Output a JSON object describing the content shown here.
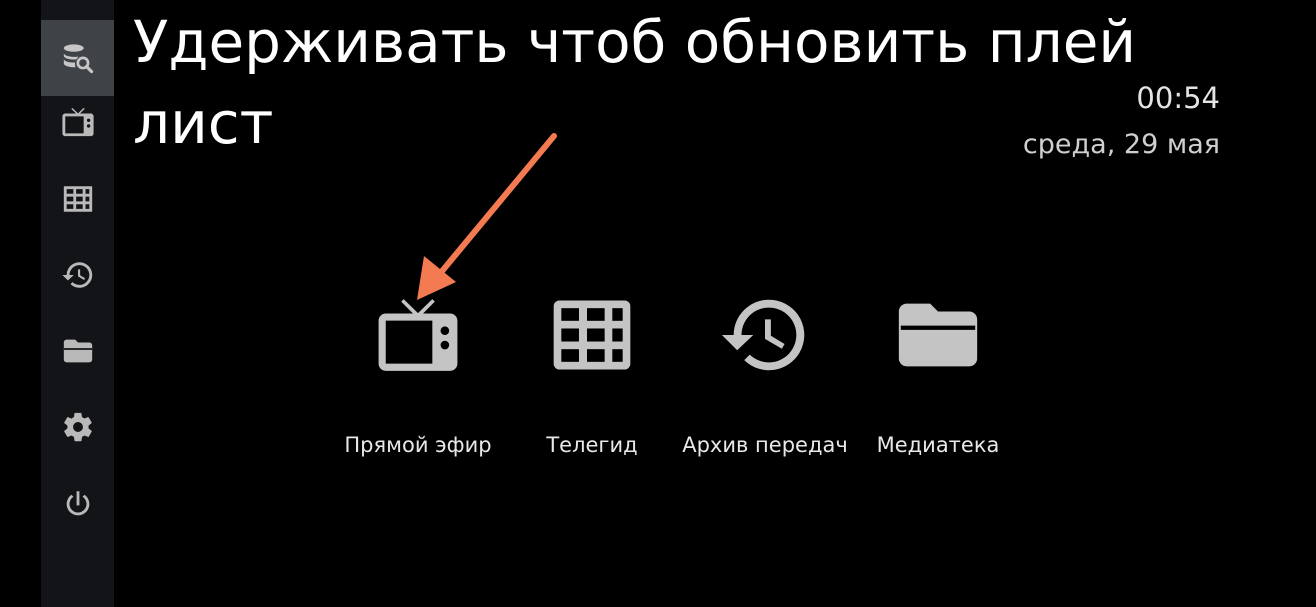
{
  "header": {
    "hint": "Удерживать чтоб обновить плей лист",
    "time": "00:54",
    "date": "среда, 29 мая"
  },
  "sidebar": {
    "items": [
      {
        "icon": "database-search-icon",
        "active": true
      },
      {
        "icon": "tv-icon",
        "active": false
      },
      {
        "icon": "grid-icon",
        "active": false
      },
      {
        "icon": "history-icon",
        "active": false
      },
      {
        "icon": "folder-icon",
        "active": false
      },
      {
        "icon": "gear-icon",
        "active": false
      },
      {
        "icon": "power-icon",
        "active": false
      }
    ]
  },
  "menu": {
    "items": [
      {
        "label": "Прямой эфир",
        "icon": "tv-icon"
      },
      {
        "label": "Телегид",
        "icon": "grid-icon"
      },
      {
        "label": "Архив передач",
        "icon": "history-icon"
      },
      {
        "label": "Медиатека",
        "icon": "folder-icon"
      }
    ]
  },
  "colors": {
    "background": "#000000",
    "sidebar": "#121417",
    "sidebar_active": "#3f4246",
    "icon": "#c4c4c4",
    "arrow": "#f47a52"
  }
}
